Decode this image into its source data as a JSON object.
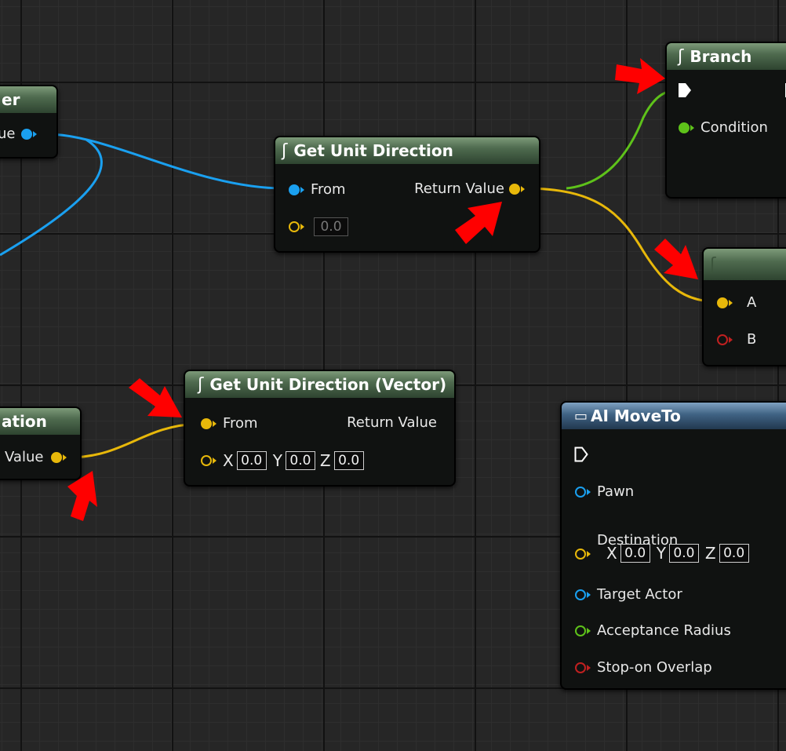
{
  "nodes": {
    "partial_top_left": {
      "title_fragment": "er",
      "pin_label": "lue"
    },
    "get_unit_direction": {
      "title": "Get Unit Direction",
      "from_label": "From",
      "return_label": "Return Value",
      "default_value": "0.0"
    },
    "branch": {
      "title": "Branch",
      "condition_label": "Condition"
    },
    "partial_compare": {
      "pin_a": "A",
      "pin_b": "B"
    },
    "partial_bottom_left": {
      "title_fragment": "ation",
      "pin_label": "Value"
    },
    "get_unit_direction_vector": {
      "title": "Get Unit Direction (Vector)",
      "from_label": "From",
      "return_label": "Return Value",
      "axes": [
        "X",
        "Y",
        "Z"
      ],
      "values": [
        "0.0",
        "0.0",
        "0.0"
      ]
    },
    "ai_move_to": {
      "title": "AI MoveTo",
      "pins": {
        "pawn": "Pawn",
        "destination": "Destination",
        "target_actor": "Target Actor",
        "acceptance_radius": "Acceptance Radius",
        "stop_on_overlap": "Stop-on Overlap"
      },
      "axes": [
        "X",
        "Y",
        "Z"
      ],
      "values": [
        "0.0",
        "0.0",
        "0.0"
      ]
    }
  },
  "colors": {
    "vector_pin": "#e8b80a",
    "object_pin": "#1aa0f0",
    "bool_pin": "#5ec21a",
    "float_pin": "#5ec21a",
    "red_pin": "#c02020",
    "annotation_arrow": "#ff0000"
  },
  "icons": [
    "function-icon",
    "exec-pin-icon",
    "ai-task-icon",
    "annotation-arrow-icon"
  ]
}
